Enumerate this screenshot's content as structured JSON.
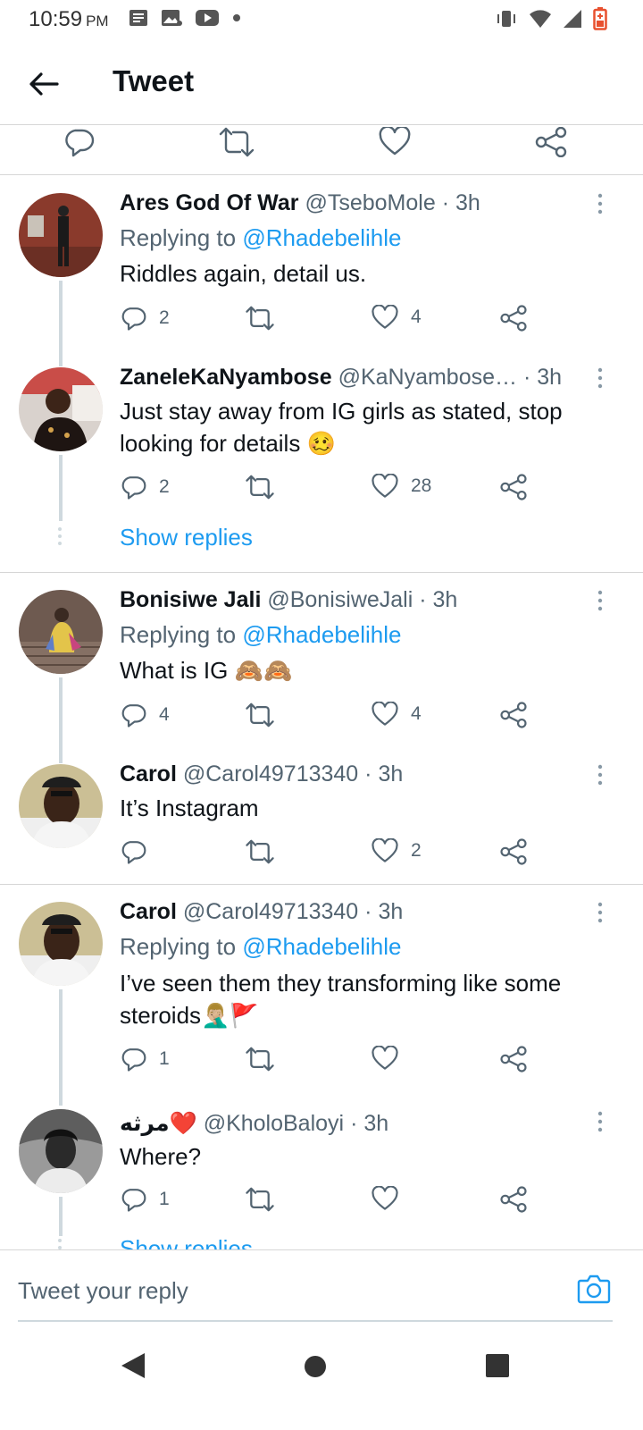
{
  "status_bar": {
    "time": "10:59",
    "ampm": "PM"
  },
  "header": {
    "title": "Tweet",
    "back_icon": "arrow-left-icon"
  },
  "colors": {
    "accent": "#1d9bf0",
    "secondary_text": "#536471",
    "primary_text": "#0f1419",
    "divider": "#d6d6d6"
  },
  "tweets": [
    {
      "name": "Ares God Of War",
      "handle": "@TseboMole",
      "time": "· 3h",
      "replying_label": "Replying to ",
      "replying_to": "@Rhadebelihle",
      "text": "Riddles again, detail us.",
      "replies": "2",
      "likes": "4"
    },
    {
      "name": "ZaneleKaNyambose",
      "handle": "@KaNyambose…",
      "time": "· 3h",
      "text": "Just stay away from IG girls as stated, stop looking for details 🥴",
      "replies": "2",
      "likes": "28",
      "show_replies": "Show replies"
    },
    {
      "name": "Bonisiwe Jali",
      "handle": "@BonisiweJali",
      "time": "· 3h",
      "replying_label": "Replying to ",
      "replying_to": "@Rhadebelihle",
      "text": "What is IG 🙈🙈",
      "replies": "4",
      "likes": "4"
    },
    {
      "name": "Carol",
      "handle": "@Carol49713340",
      "time": "· 3h",
      "text": "It’s Instagram",
      "replies": "",
      "likes": "2"
    },
    {
      "name": "Carol",
      "handle": "@Carol49713340",
      "time": "· 3h",
      "replying_label": "Replying to ",
      "replying_to": "@Rhadebelihle",
      "text": "I’ve seen them they transforming like some steroids🤦🏼‍♂️🚩",
      "replies": "1",
      "likes": ""
    },
    {
      "name": "مرثه❤️",
      "handle": "@KholoBaloyi",
      "time": "· 3h",
      "text": "Where?",
      "replies": "1",
      "likes": "",
      "show_replies": "Show replies"
    }
  ],
  "composer": {
    "placeholder": "Tweet your reply"
  }
}
